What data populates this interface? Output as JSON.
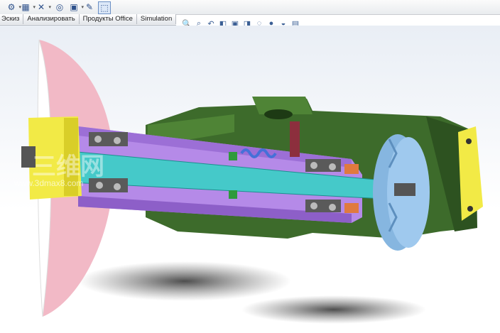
{
  "toolbar": {
    "icons": [
      "rebuild-icon",
      "options-icon",
      "dimension-icon",
      "smart-icon",
      "sketch-tool-icon",
      "select-icon"
    ]
  },
  "tabs": [
    {
      "label": "Эскиз"
    },
    {
      "label": "Анализировать"
    },
    {
      "label": "Продукты Office"
    },
    {
      "label": "Simulation"
    }
  ],
  "heads_up": {
    "icons": [
      "zoom-to-fit-icon",
      "zoom-area-icon",
      "previous-view-icon",
      "section-view-icon",
      "view-orientation-icon",
      "display-style-icon",
      "hide-show-icon",
      "appearance-icon",
      "scene-icon",
      "view-settings-icon"
    ]
  },
  "watermark": {
    "cn_text": "三维网",
    "url_text": "www.3dmax8.com"
  },
  "colors": {
    "housing": "#3d6b2b",
    "sleeve": "#b58ae8",
    "shaft": "#45c9c9",
    "blade": "#f2b9c6",
    "pulley": "#9fc9ee",
    "flange": "#f2ea46"
  }
}
